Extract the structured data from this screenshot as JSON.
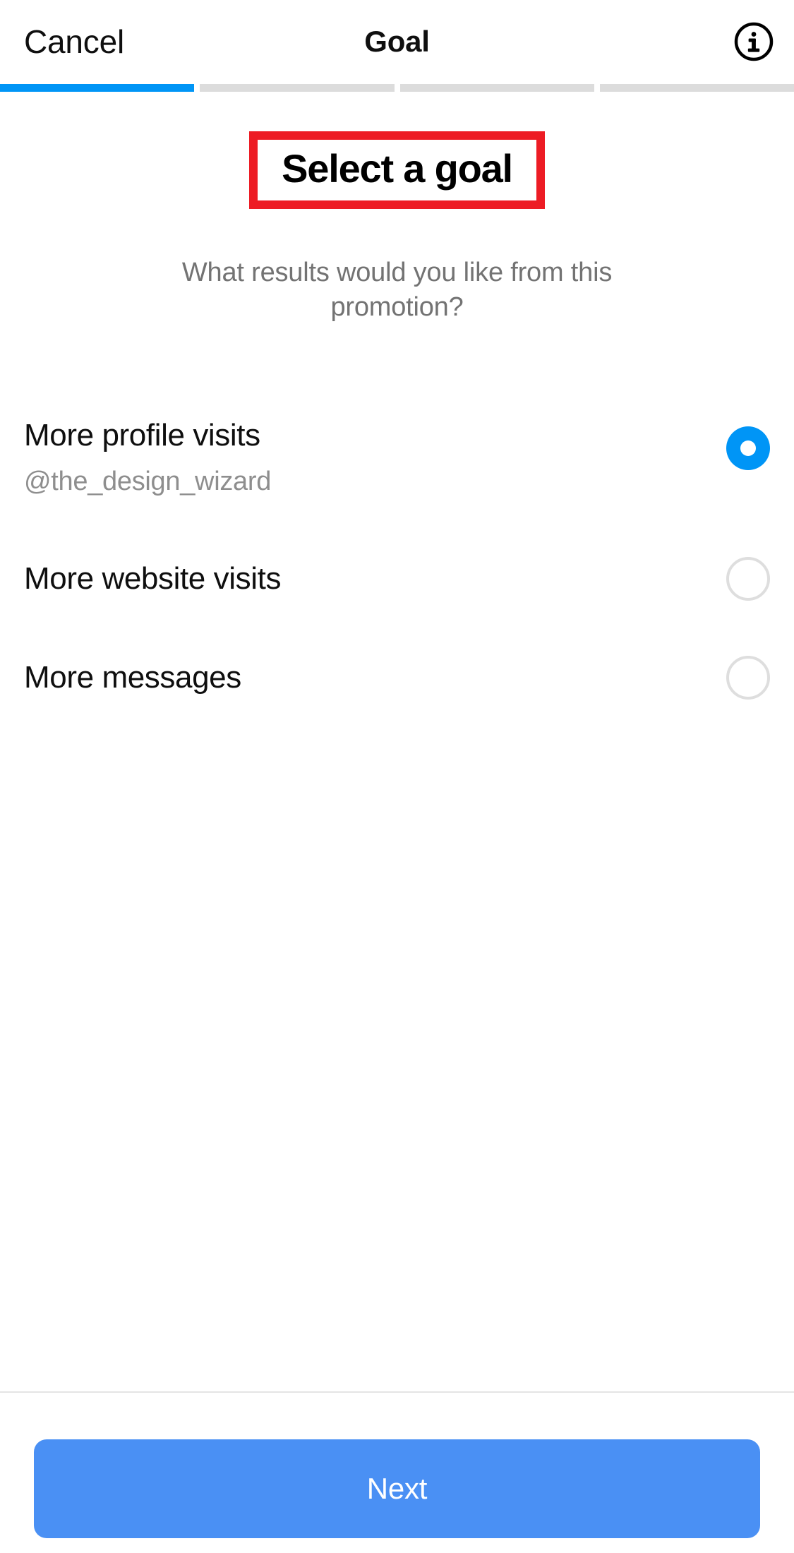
{
  "navbar": {
    "cancel_label": "Cancel",
    "title": "Goal",
    "info_icon": "info-circle-icon"
  },
  "progress": {
    "total_steps": 4,
    "current_step": 1,
    "active_color": "#0095f6",
    "inactive_color": "#dcdcdc"
  },
  "header": {
    "headline": "Select a goal",
    "subhead": "What results would you like from this promotion?",
    "highlight_color": "#ed1c24"
  },
  "options": [
    {
      "label": "More profile visits",
      "sublabel": "@the_design_wizard",
      "selected": true
    },
    {
      "label": "More website visits",
      "sublabel": "",
      "selected": false
    },
    {
      "label": "More messages",
      "sublabel": "",
      "selected": false
    }
  ],
  "footer": {
    "next_label": "Next",
    "next_color": "#4a90f4"
  }
}
